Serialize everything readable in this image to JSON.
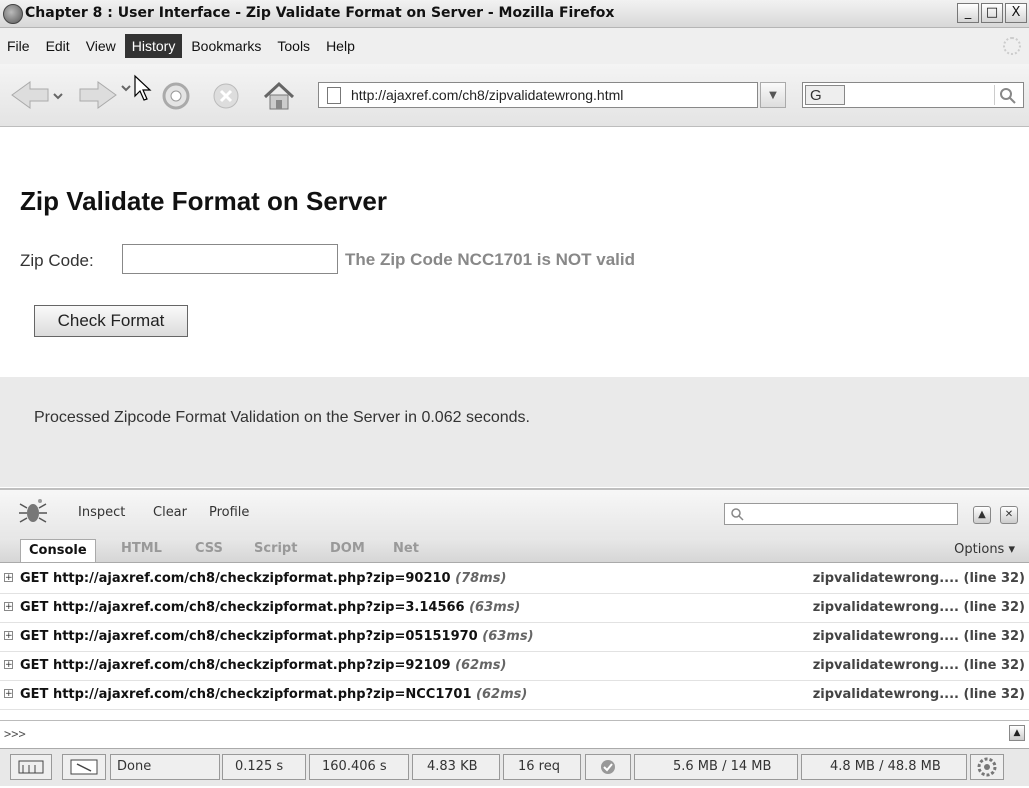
{
  "window": {
    "title": "Chapter 8 : User Interface - Zip Validate Format on Server - Mozilla Firefox"
  },
  "window_buttons": [
    "_",
    "□",
    "X"
  ],
  "menu": {
    "items": [
      "File",
      "Edit",
      "View",
      "History",
      "Bookmarks",
      "Tools",
      "Help"
    ],
    "active": "History"
  },
  "navbar": {
    "url": "http://ajaxref.com/ch8/zipvalidatewrong.html",
    "search_engine": "G",
    "search_placeholder": ""
  },
  "page": {
    "heading": "Zip Validate Format on Server",
    "zip_label": "Zip Code:",
    "zip_value": "",
    "validation_message": "The Zip Code NCC1701 is NOT valid",
    "check_button": "Check Format",
    "status_message": "Processed Zipcode Format Validation on the Server in 0.062 seconds."
  },
  "firebug": {
    "tools": [
      "Inspect",
      "Clear",
      "Profile"
    ],
    "search_placeholder": "",
    "tabs": [
      "Console",
      "HTML",
      "CSS",
      "Script",
      "DOM",
      "Net"
    ],
    "active_tab": "Console",
    "options_label": "Options ▾",
    "log": [
      {
        "request": "GET http://ajaxref.com/ch8/checkzipformat.php?zip=90210",
        "time": "(78ms)",
        "source": "zipvalidatewrong.... (line 32)"
      },
      {
        "request": "GET http://ajaxref.com/ch8/checkzipformat.php?zip=3.14566",
        "time": "(63ms)",
        "source": "zipvalidatewrong.... (line 32)"
      },
      {
        "request": "GET http://ajaxref.com/ch8/checkzipformat.php?zip=05151970",
        "time": "(63ms)",
        "source": "zipvalidatewrong.... (line 32)"
      },
      {
        "request": "GET http://ajaxref.com/ch8/checkzipformat.php?zip=92109",
        "time": "(62ms)",
        "source": "zipvalidatewrong.... (line 32)"
      },
      {
        "request": "GET http://ajaxref.com/ch8/checkzipformat.php?zip=NCC1701",
        "time": "(62ms)",
        "source": "zipvalidatewrong.... (line 32)"
      }
    ],
    "command_prompt": ">>>"
  },
  "statusbar": {
    "done": "Done",
    "load_time": "0.125 s",
    "total_time": "160.406 s",
    "size": "4.83 KB",
    "requests": "16 req",
    "memory1": "5.6 MB / 14 MB",
    "memory2": "4.8 MB / 48.8 MB"
  },
  "icons": [
    "firefox-icon",
    "back-arrow-icon",
    "forward-arrow-icon",
    "reload-icon",
    "stop-icon",
    "home-icon",
    "page-icon",
    "go-arrow-icon",
    "search-icon",
    "firebug-icon",
    "cursor-icon",
    "layout-icon",
    "inspect-icon",
    "check-icon",
    "gear-icon"
  ]
}
